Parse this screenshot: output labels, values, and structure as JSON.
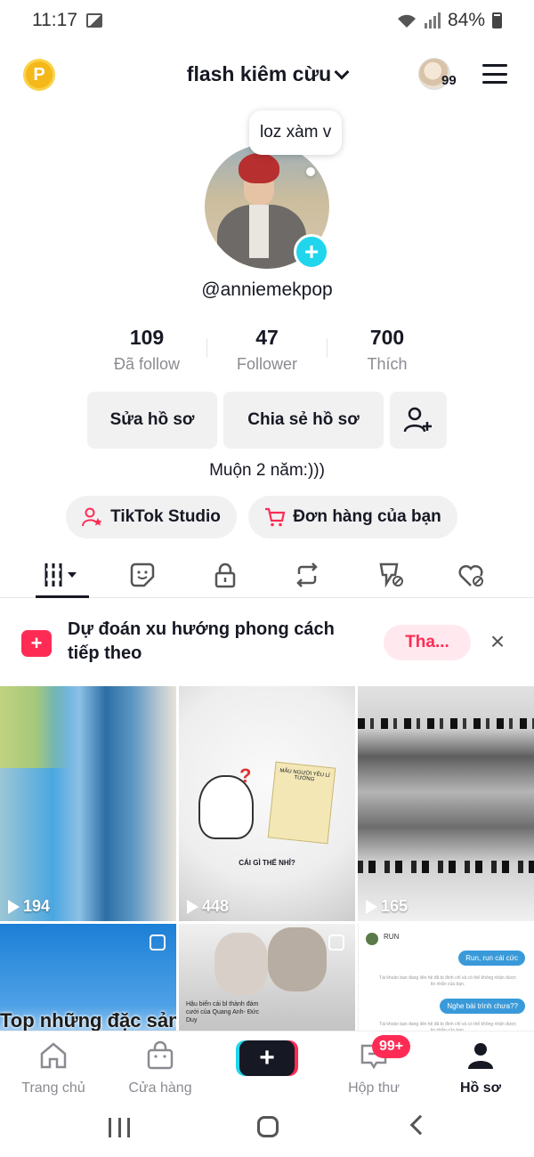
{
  "status_bar": {
    "time": "11:17",
    "battery": "84%"
  },
  "header": {
    "coin_label": "P",
    "username": "flash kiêm cừu",
    "notification_count": "99"
  },
  "profile": {
    "note": "loz xàm v",
    "handle": "@anniemekpop",
    "stats": [
      {
        "value": "109",
        "label": "Đã follow"
      },
      {
        "value": "47",
        "label": "Follower"
      },
      {
        "value": "700",
        "label": "Thích"
      }
    ],
    "edit_label": "Sửa hồ sơ",
    "share_label": "Chia sẻ hồ sơ",
    "bio": "Muộn 2 năm:)))",
    "studio_label": "TikTok Studio",
    "orders_label": "Đơn hàng của bạn"
  },
  "tabs": [
    "videos-grid-icon",
    "favorites-icon",
    "private-lock-icon",
    "repost-icon",
    "tagged-hidden-icon",
    "liked-hidden-icon"
  ],
  "promo": {
    "text": "Dự đoán xu hướng phong cách tiếp theo",
    "button": "Tha..."
  },
  "videos": [
    {
      "views": "194"
    },
    {
      "views": "448",
      "note_text": "MẪU NGƯỜI YÊU LÍ TƯỞNG",
      "caption": "CÁI GÌ THẾ NHỈ?"
    },
    {
      "views": "165"
    },
    {
      "overlay_text": "Top những đặc sản"
    },
    {
      "caption": "Hậu biến cái bl thành đám cưới của Quang Anh- Đức Duy"
    },
    {
      "name": "RUN",
      "bubble1": "Run, run cái cức",
      "bubble2": "Nghe bài trình chưa??",
      "system_text": "Tài khoản bạn đang liên hệ đã bị đình chỉ và có thể không nhận được tin nhắn của bạn."
    }
  ],
  "bottom_nav": {
    "items": [
      "Trang chủ",
      "Cửa hàng",
      "Hộp thư",
      "Hồ sơ"
    ],
    "inbox_badge": "99+",
    "create_label": "+"
  },
  "colors": {
    "brand_red": "#fe2c55",
    "brand_cyan": "#20d5ec",
    "text": "#161823",
    "muted": "#8a8b91"
  }
}
